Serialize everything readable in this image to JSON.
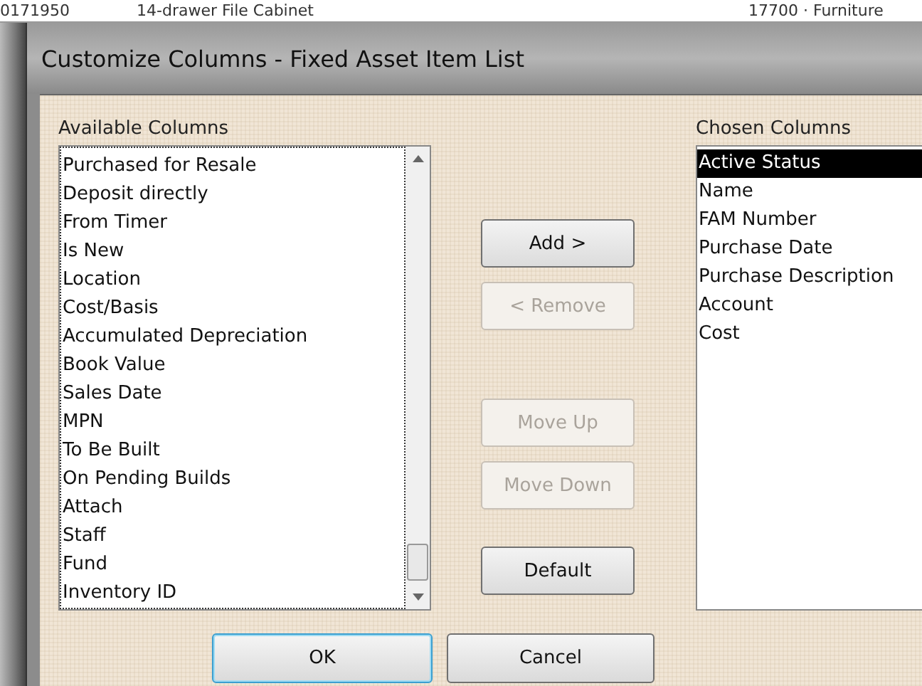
{
  "background_row": {
    "cells": [
      "0171950",
      "14-drawer File Cabinet",
      "17700 · Furniture"
    ]
  },
  "window": {
    "title": "Customize Columns - Fixed Asset Item List"
  },
  "available": {
    "label": "Available Columns",
    "items": [
      "Purchased for Resale",
      "Deposit directly",
      "From Timer",
      "Is New",
      "Location",
      "Cost/Basis",
      "Accumulated Depreciation",
      "Book Value",
      "Sales Date",
      "MPN",
      "To Be Built",
      "On Pending Builds",
      "Attach",
      "Staff",
      "Fund",
      "Inventory ID"
    ]
  },
  "middle_buttons": [
    {
      "label": "Add >",
      "disabled": false
    },
    {
      "label": "< Remove",
      "disabled": true
    },
    {
      "label": "Move Up",
      "disabled": true
    },
    {
      "label": "Move Down",
      "disabled": true
    },
    {
      "label": "Default",
      "disabled": false
    }
  ],
  "chosen": {
    "label": "Chosen Columns",
    "items": [
      {
        "label": "Active Status",
        "selected": true
      },
      {
        "label": "Name",
        "selected": false
      },
      {
        "label": "FAM Number",
        "selected": false
      },
      {
        "label": "Purchase Date",
        "selected": false
      },
      {
        "label": "Purchase Description",
        "selected": false
      },
      {
        "label": "Account",
        "selected": false
      },
      {
        "label": "Cost",
        "selected": false
      }
    ]
  },
  "buttons": [
    {
      "label": "OK",
      "default": true
    },
    {
      "label": "Cancel",
      "default": false
    }
  ]
}
